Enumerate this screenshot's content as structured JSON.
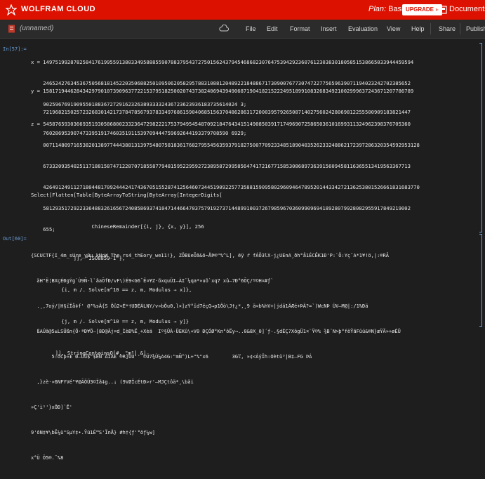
{
  "topbar": {
    "brand": "WOLFRAM CLOUD",
    "plan_label": "Plan:",
    "plan_value": "Basic",
    "upgrade": "UPGRADE »",
    "documents": "Documents"
  },
  "menubar": {
    "title": "(unnamed)",
    "items": [
      "File",
      "Edit",
      "Format",
      "Insert",
      "Evaluation",
      "View",
      "Help",
      "Share",
      "Publish"
    ]
  },
  "cells": {
    "in_label": "In[57]:=",
    "out_label": "Out[60]=",
    "x_lines": [
      "x = 14975199287825841761995591380334958885590788379543727501562437945468682307647539429236076123038301805851538665033944459594",
      "    2465242763453675056818145220350688250109506205829578831088120489221848867173090076773074722775659639071194023242702385652",
      "    9025967691909550188367272916232638933332436723623936183735614024 3;"
    ],
    "y_lines": [
      "y = 15817194462843429790107390963772215379518250020743738240694394906871904182152224951899108326834921002999637243671207786789",
      "    7219682150257232683014217378478567937833497686159040685156370486286317200039579265087140275602428069812255500909183821447",
      "    7602869539074733951917460351911539709444759692644193379708590 6929;"
    ],
    "z_lines": [
      "z = 5458765930366935193058680023323647298222175379495454870921847643415149085039171749690725865036101699311324962398376705360",
      "    0071148097165382013897744438813139754807581836176827955456359379182750077092334851890403526233248862172397286320354592953128",
      "    6733209354025117188158747122870718558779481595229592723895872995856474172167715853086897363915609458116365513419563367713",
      "    4264912491127180448170924442417436705155287412564607344519092257735881590958029609464789520144334272136253801526661831683770",
      "    5812935172922336488326165672408586937410471446647037579192737144899100372679859670360990969418928079928082955917849219002",
      "    655;"
    ],
    "select_lines": [
      "Select[Flatten[Table[ByteArrayToString[ByteArray[IntegerDigits[",
      "                    ChineseRemainder[{i, j}, {x, y}], 256",
      "              ]], \"ISO8859-1\"],",
      "          {i, m /. Solve[m^10 == z, m, Modulus → x]},",
      "          {j, m /. Solve[m^10 == z, m, Modulus → y]}",
      "        ]], StringContainsQ[#, \"m\"] &]"
    ],
    "out_lines": [
      "{SCUCTF{I_4m_sUre_y0u_kNoW_The_rs4_thEory_we11!}, ZÖBüeÕã&ö~ÅÞ®\"%^L], ëÿ ŕ fÁÖ3lX-j¿UEnA¸ðh°å1ÉCÊK1Ð'P:`Ö:Yç¯A*1¥!ö,|:®RÂ",
      "  äH\"Ë¦BXçÉÐgÝg`Ù9Ñ-l`ãaÕfÐ/vF\\)É9<G6¯Ë¤¥Z·õxquÜI—ÀI¨¼qa*»uõ`xq7 xû—7Ð°6ÕÇ/º©H¤#ƒ`",
      "  .¸,7oý/|H§ïÏå‡f' @³%sÄ{S Öû2<É*†UDÉÁLNY/v»bÕu0,l×]zÝ°ïd7ëçQ→p1Ôò\\J†¿*,¸9 ä<b%hV+|jdä1ÄÆé+ÞÄ?=`)WcNÞ ÙV—M@|:/1%Ðä",
      "  ßAÚã@5±LSÜßn{Ö·ªÐ¥Ö—[8Ð@Äj¤d_ÌèÐ%Ë¸+Xèä  Iº§ÜÀ·ÜEKû\\«V0 ÐÇÓØ°Kn°ôËy¬..0&8X_0]´ƒ-.§dÉÇ?XôgÜ1¤`Ÿ©% ¾B¨N>þ°fëŸãFûü&®N}æŸÄ»»øÈÜ",
      "       5:ôCþ«£ Ð—Ùû$\"$ÊÑ`ÄÌÁ£ ®R]ÜÜ'' ©Ü7¾Ù¼A4G:\"mÑ^)L+\"%\"x6        3Gľ, »¢<ÁýÎh:Oètü³|B‡—FG ÞÁ",
      "  ,}zè·»6NFYVé\"¥@ÃÖÜ3©Ïã‡g..¡ (9VØÏcÉtÐ>r'—MJÇtôä*¸\\bäi",
      "»Ç'ì¹'}xÕÐ]`Ê'",
      "9'ôN‡¥\\bÊ¼ü\"SµY‡•.Ÿü1É™S'ÏnÅ} #h†{ƒ'°ôƒ¼w]",
      "x°Ü Ö5®.¯%8"
    ]
  }
}
